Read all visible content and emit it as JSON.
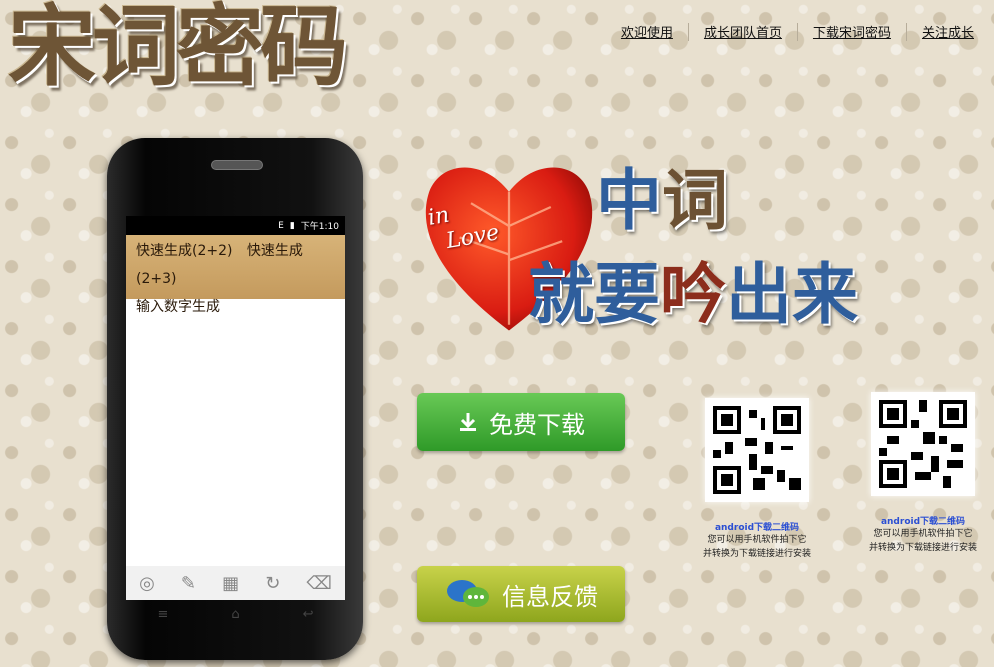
{
  "brand": {
    "logo_text": "宋词密码"
  },
  "nav": {
    "items": [
      "欢迎使用",
      "成长团队首页",
      "下载宋词密码",
      "关注成长"
    ]
  },
  "phone": {
    "status": {
      "signal": "E",
      "time": "下午1:10"
    },
    "buttons": [
      "快速生成(2+2)",
      "快速生成(2+3)",
      "输入数字生成"
    ]
  },
  "hero": {
    "heart_text_1": "in",
    "heart_text_2": "Love",
    "slogan": {
      "c1": "中",
      "c2": "词",
      "c3": "就要",
      "c4": "吟",
      "c5": "出来"
    }
  },
  "actions": {
    "download_label": "免费下载",
    "feedback_label": "信息反馈"
  },
  "qr": [
    {
      "caption": "android下载二维码",
      "note1": "您可以用手机软件拍下它",
      "note2": "并转换为下载链接进行安装"
    },
    {
      "caption": "android下载二维码",
      "note1": "您可以用手机软件拍下它",
      "note2": "并转换为下载链接进行安装"
    }
  ],
  "colors": {
    "accent_green": "#2f9a28",
    "accent_olive": "#8ea61d",
    "slogan_blue": "#2f5e9c",
    "heart_red": "#e02418"
  }
}
